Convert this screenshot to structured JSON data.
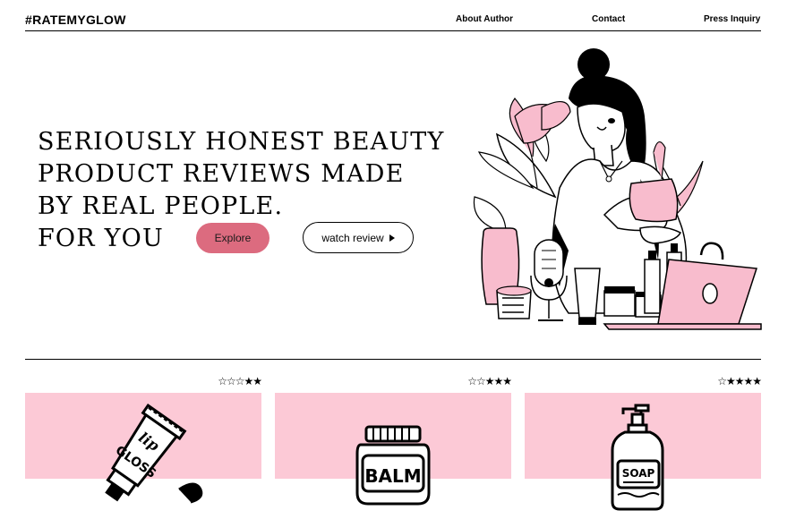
{
  "header": {
    "logo": "#RATEMYGLOW",
    "nav": [
      "About Author",
      "Contact",
      "Press Inquiry"
    ]
  },
  "hero": {
    "title_lines": [
      "Seriously honest beauty",
      "product reviews made",
      "by real people.",
      "For you"
    ],
    "explore_label": "Explore",
    "watch_label": "watch review"
  },
  "colors": {
    "accent": "#dc6b7f",
    "card_pink": "#fcc9d6",
    "illustration_pink": "#f8bccd"
  },
  "products": [
    {
      "name": "lip gloss",
      "label_lines": [
        "lip",
        "GLOSS"
      ],
      "stars": "☆☆☆★★",
      "rating": 2
    },
    {
      "name": "balm",
      "label_lines": [
        "BALM"
      ],
      "stars": "☆☆★★★",
      "rating": 3
    },
    {
      "name": "soap",
      "label_lines": [
        "SOAP"
      ],
      "stars": "☆★★★★",
      "rating": 4
    }
  ]
}
